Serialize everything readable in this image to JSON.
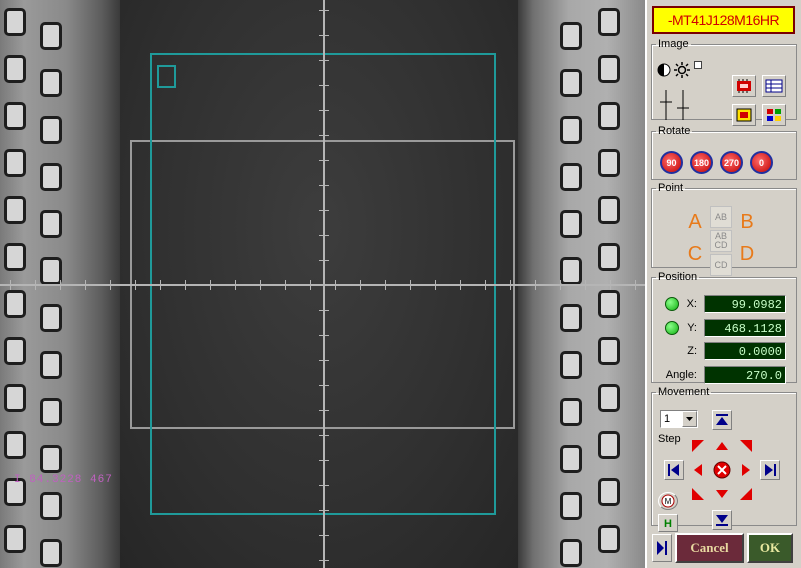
{
  "device_title": "-MT41J128M16HR",
  "image_group": {
    "legend": "Image"
  },
  "rotate_group": {
    "legend": "Rotate",
    "buttons": [
      "90",
      "180",
      "270",
      "0"
    ]
  },
  "point_group": {
    "legend": "Point",
    "a": "A",
    "b": "B",
    "c": "C",
    "d": "D",
    "ab": "AB",
    "abcd_top": "AB",
    "abcd_bottom": "CD",
    "cd": "CD"
  },
  "position_group": {
    "legend": "Position",
    "x_label": "X:",
    "x_value": "99.0982",
    "y_label": "Y:",
    "y_value": "468.1128",
    "z_label": "Z:",
    "z_value": "0.0000",
    "angle_label": "Angle:",
    "angle_value": "270.0"
  },
  "movement_group": {
    "legend": "Movement",
    "step_select": "1",
    "step_label": "Step"
  },
  "viewer": {
    "coord_readout": "I  84.3228   467"
  },
  "buttons": {
    "cancel": "Cancel",
    "ok": "OK"
  },
  "colors": {
    "accent_red": "#d00000",
    "title_bg": "#ffff00",
    "overlay_cyan": "#1f9a9a",
    "display_green": "#003300"
  }
}
